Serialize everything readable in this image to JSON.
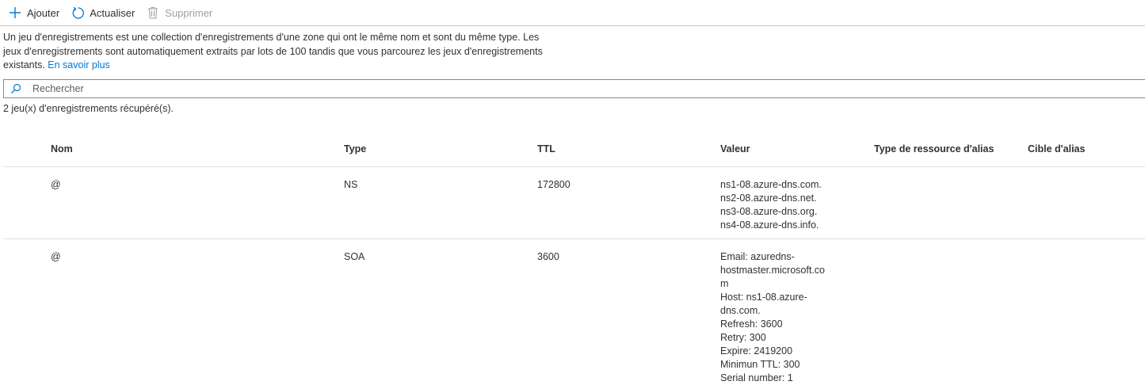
{
  "toolbar": {
    "add_label": "Ajouter",
    "refresh_label": "Actualiser",
    "delete_label": "Supprimer"
  },
  "description": {
    "line1": "Un jeu d'enregistrements est une collection d'enregistrements d'une zone qui ont le même nom et sont du même type. Les",
    "line2": "jeux d'enregistrements sont automatiquement extraits par lots de 100 tandis que vous parcourez les jeux d'enregistrements",
    "line3": "existants.",
    "link": "En savoir plus"
  },
  "search": {
    "placeholder": "Rechercher"
  },
  "status": {
    "count_text": "2 jeu(x) d'enregistrements récupéré(s)."
  },
  "table": {
    "headers": {
      "nom": "Nom",
      "type": "Type",
      "ttl": "TTL",
      "valeur": "Valeur",
      "alias_type": "Type de ressource d'alias",
      "alias_target": "Cible d'alias"
    },
    "rows": [
      {
        "nom": "@",
        "type": "NS",
        "ttl": "172800",
        "valeur": [
          "ns1-08.azure-dns.com.",
          "ns2-08.azure-dns.net.",
          "ns3-08.azure-dns.org.",
          "ns4-08.azure-dns.info."
        ]
      },
      {
        "nom": "@",
        "type": "SOA",
        "ttl": "3600",
        "valeur": [
          "Email: azuredns-",
          "hostmaster.microsoft.co",
          "m",
          "Host: ns1-08.azure-",
          "dns.com.",
          "Refresh: 3600",
          "Retry: 300",
          "Expire: 2419200",
          "Minimun TTL: 300",
          "Serial number: 1"
        ]
      }
    ]
  },
  "colors": {
    "accent": "#0078d4",
    "disabled": "#a19f9d",
    "border": "#e1dfdd"
  }
}
